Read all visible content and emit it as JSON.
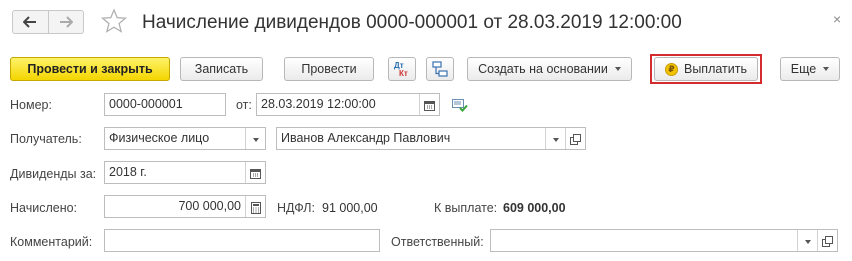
{
  "window": {
    "title": "Начисление дивидендов 0000-000001 от 28.03.2019 12:00:00",
    "close_glyph": "×"
  },
  "nav": {
    "back_icon": "arrow-left-icon",
    "forward_icon": "arrow-right-icon",
    "favorite_icon": "star-icon"
  },
  "toolbar": {
    "post_and_close": "Провести и закрыть",
    "write": "Записать",
    "post": "Провести",
    "dtkt_icon": "dt-kt-icon",
    "structure_icon": "document-structure-icon",
    "create_based_on": "Создать на основании",
    "pay": "Выплатить",
    "pay_icon": "ruble-coin-icon",
    "more": "Еще"
  },
  "form": {
    "number_label": "Номер:",
    "number_value": "0000-000001",
    "date_label": "от:",
    "date_value": "28.03.2019 12:00:00",
    "recipient_label": "Получатель:",
    "recipient_type": "Физическое лицо",
    "recipient_name": "Иванов Александр Павлович",
    "period_label": "Дивиденды за:",
    "period_value": "2018 г.",
    "accrued_label": "Начислено:",
    "accrued_value": "700 000,00",
    "ndfl_label": "НДФЛ:",
    "ndfl_value": "91 000,00",
    "payout_label": "К выплате:",
    "payout_value": "609 000,00",
    "comment_label": "Комментарий:",
    "comment_value": "",
    "responsible_label": "Ответственный:",
    "responsible_value": ""
  },
  "colors": {
    "primary_button": "#f4d500",
    "highlight_frame": "#d42c2c"
  }
}
